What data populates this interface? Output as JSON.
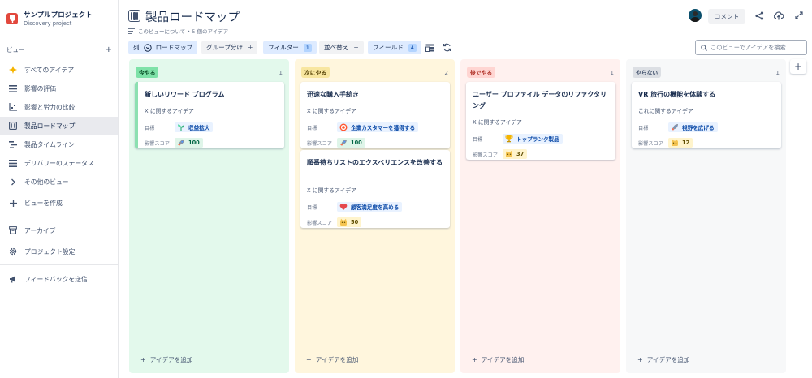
{
  "project": {
    "name": "サンプルプロジェクト",
    "subtitle": "Discovery project"
  },
  "sidebar": {
    "section_label": "ビュー",
    "section_plus": "+",
    "items": [
      {
        "label": "すべてのアイデア",
        "icon": "sparkle-icon"
      },
      {
        "label": "影響の評価",
        "icon": "list-icon"
      },
      {
        "label": "影響と労力の比較",
        "icon": "scatter-icon"
      },
      {
        "label": "製品ロードマップ",
        "icon": "board-icon"
      },
      {
        "label": "製品タイムライン",
        "icon": "timeline-icon"
      },
      {
        "label": "デリバリーのステータス",
        "icon": "list-icon"
      },
      {
        "label": "その他のビュー",
        "icon": "chevron-right-icon"
      },
      {
        "label": "ビューを作成",
        "icon": "plus-icon"
      },
      {
        "label": "アーカイブ",
        "icon": "archive-icon"
      },
      {
        "label": "プロジェクト設定",
        "icon": "gear-icon"
      },
      {
        "label": "フィードバックを送信",
        "icon": "megaphone-icon"
      }
    ],
    "active_index": 3
  },
  "header": {
    "title": "製品ロードマップ",
    "subtitle": "このビューについて • 5 個のアイデア",
    "comment_label": "コメント"
  },
  "toolbar": {
    "column_prefix": "列",
    "column_value": "ロードマップ",
    "group_label": "グループ分け",
    "filter_label": "フィルター",
    "filter_count": "1",
    "sort_label": "並べ替え",
    "fields_label": "フィールド",
    "fields_count": "4",
    "plus": "+",
    "search_placeholder": "このビューでアイデアを検索"
  },
  "columns": [
    {
      "tag": "今やる",
      "count": "1",
      "add_label": "アイデアを追加",
      "bg": "#e3f9ec",
      "tag_bg": "#7ee2a8",
      "tag_color": "#064b23",
      "cards": [
        {
          "title": "新しいリワード プログラム",
          "desc": "X に関するアイデア",
          "goal_label": "目標",
          "goal": "収益拡大",
          "goal_icon": "seedling-icon",
          "score_label": "影響スコア",
          "score": "100",
          "score_icon": "rocket-icon"
        }
      ]
    },
    {
      "tag": "次にやる",
      "count": "2",
      "add_label": "アイデアを追加",
      "bg": "#fff6dd",
      "tag_bg": "#f8e6a0",
      "tag_color": "#533f04",
      "cards": [
        {
          "title": "迅速な購入手続き",
          "desc": "X に関するアイデア",
          "goal_label": "目標",
          "goal": "企業カスタマーを獲得する",
          "goal_icon": "target-icon",
          "score_label": "影響スコア",
          "score": "100",
          "score_icon": "rocket-icon"
        },
        {
          "title": "順番待ちリストのエクスペリエンスを改善する",
          "desc": "X に関するアイデア",
          "goal_label": "目標",
          "goal": "顧客満足度を高める",
          "goal_icon": "heart-icon",
          "score_label": "影響スコア",
          "score": "50",
          "score_icon": "cat-icon"
        }
      ]
    },
    {
      "tag": "後でやる",
      "count": "1",
      "add_label": "アイデアを追加",
      "bg": "#fff1ef",
      "tag_bg": "#ffd5d2",
      "tag_color": "#ae2e24",
      "cards": [
        {
          "title": "ユーザー プロファイル データのリファクタリング",
          "desc": "X に関するアイデア",
          "goal_label": "目標",
          "goal": "トップランク製品",
          "goal_icon": "trophy-icon",
          "score_label": "影響スコア",
          "score": "37",
          "score_icon": "cat-icon"
        }
      ]
    },
    {
      "tag": "やらない",
      "count": "1",
      "add_label": "アイデアを追加",
      "bg": "#f7f8f9",
      "tag_bg": "#dcdfe4",
      "tag_color": "#44546f",
      "cards": [
        {
          "title": "VR 旅行の機能を体験する",
          "desc": "これに関するアイデア",
          "goal_label": "目標",
          "goal": "視野を広げる",
          "goal_icon": "rocket-icon",
          "score_label": "影響スコア",
          "score": "12",
          "score_icon": "cat-icon"
        }
      ]
    }
  ]
}
